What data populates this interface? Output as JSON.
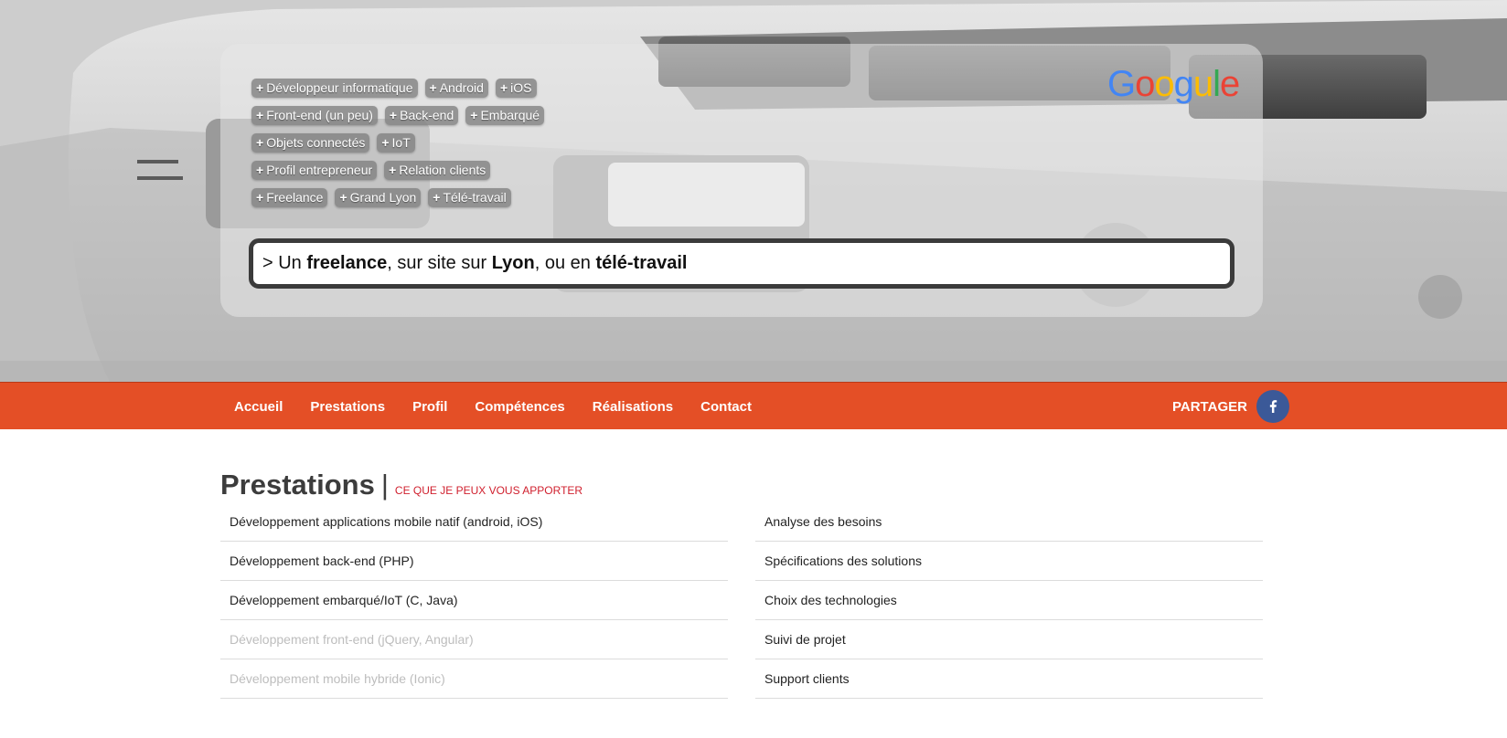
{
  "hero": {
    "tags": [
      [
        "Développeur informatique",
        "Android",
        "iOS"
      ],
      [
        "Front-end (un peu)",
        "Back-end",
        "Embarqué"
      ],
      [
        "Objets connectés",
        "IoT"
      ],
      [
        "Profil entrepreneur",
        "Relation clients"
      ],
      [
        "Freelance",
        "Grand Lyon",
        "Télé-travail"
      ]
    ],
    "tag_prefix": "+",
    "logo_letters": [
      "G",
      "o",
      "o",
      "g",
      "u",
      "l",
      "e"
    ],
    "search": {
      "prefix": "> Un ",
      "bold1": "freelance",
      "mid1": ", sur site sur ",
      "bold2": "Lyon",
      "mid2": ", ou en ",
      "bold3": "télé-travail"
    }
  },
  "nav": {
    "items": [
      "Accueil",
      "Prestations",
      "Profil",
      "Compétences",
      "Réalisations",
      "Contact"
    ],
    "share_label": "PARTAGER",
    "share_icon": "facebook-icon"
  },
  "section": {
    "title": "Prestations",
    "separator": "|",
    "subtitle": "CE QUE JE PEUX VOUS APPORTER",
    "left_list": [
      {
        "label": "Développement applications mobile natif (android, iOS)",
        "muted": false
      },
      {
        "label": "Développement back-end (PHP)",
        "muted": false
      },
      {
        "label": "Développement embarqué/IoT (C, Java)",
        "muted": false
      },
      {
        "label": "Développement front-end (jQuery, Angular)",
        "muted": true
      },
      {
        "label": "Développement mobile hybride (Ionic)",
        "muted": true
      }
    ],
    "right_list": [
      {
        "label": "Analyse des besoins",
        "muted": false
      },
      {
        "label": "Spécifications des solutions",
        "muted": false
      },
      {
        "label": "Choix des technologies",
        "muted": false
      },
      {
        "label": "Suivi de projet",
        "muted": false
      },
      {
        "label": "Support clients",
        "muted": false
      }
    ]
  },
  "colors": {
    "nav_bg": "#e44f26",
    "subtitle": "#d0202e",
    "facebook": "#3b5998",
    "logo": [
      "#4285f4",
      "#ea4335",
      "#fbbc05",
      "#4285f4",
      "#fbbc05",
      "#34a853",
      "#ea4335"
    ]
  }
}
